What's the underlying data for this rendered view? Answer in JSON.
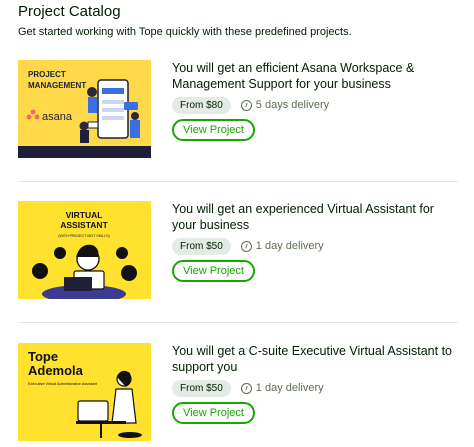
{
  "header": {
    "title": "Project Catalog",
    "subtitle": "Get started working with Tope quickly with these predefined projects."
  },
  "projects": [
    {
      "title": "You will get an efficient Asana Workspace & Management Support for your business",
      "price": "From $80",
      "delivery": "5 days delivery",
      "button": "View Project",
      "thumb": {
        "line1": "PROJECT",
        "line2": "MANAGEMENT",
        "brand": "asana"
      }
    },
    {
      "title": "You will get an experienced Virtual Assistant for your business",
      "price": "From $50",
      "delivery": "1 day delivery",
      "button": "View Project",
      "thumb": {
        "line1": "VIRTUAL",
        "line2": "ASSISTANT",
        "tag": "(WITH PROJECT MGT SKILLS)"
      }
    },
    {
      "title": "You will get a C-suite Executive Virtual Assistant to support you",
      "price": "From $50",
      "delivery": "1 day delivery",
      "button": "View Project",
      "thumb": {
        "line1": "Tope",
        "line2": "Ademola",
        "tag": "Executive Virtual Administrative Assistant"
      }
    }
  ],
  "colors": {
    "accent": "#14a800",
    "thumb_yellow": "#ffd94a",
    "thumb_dark": "#1f1f3a",
    "asana_red": "#f06a6a"
  }
}
